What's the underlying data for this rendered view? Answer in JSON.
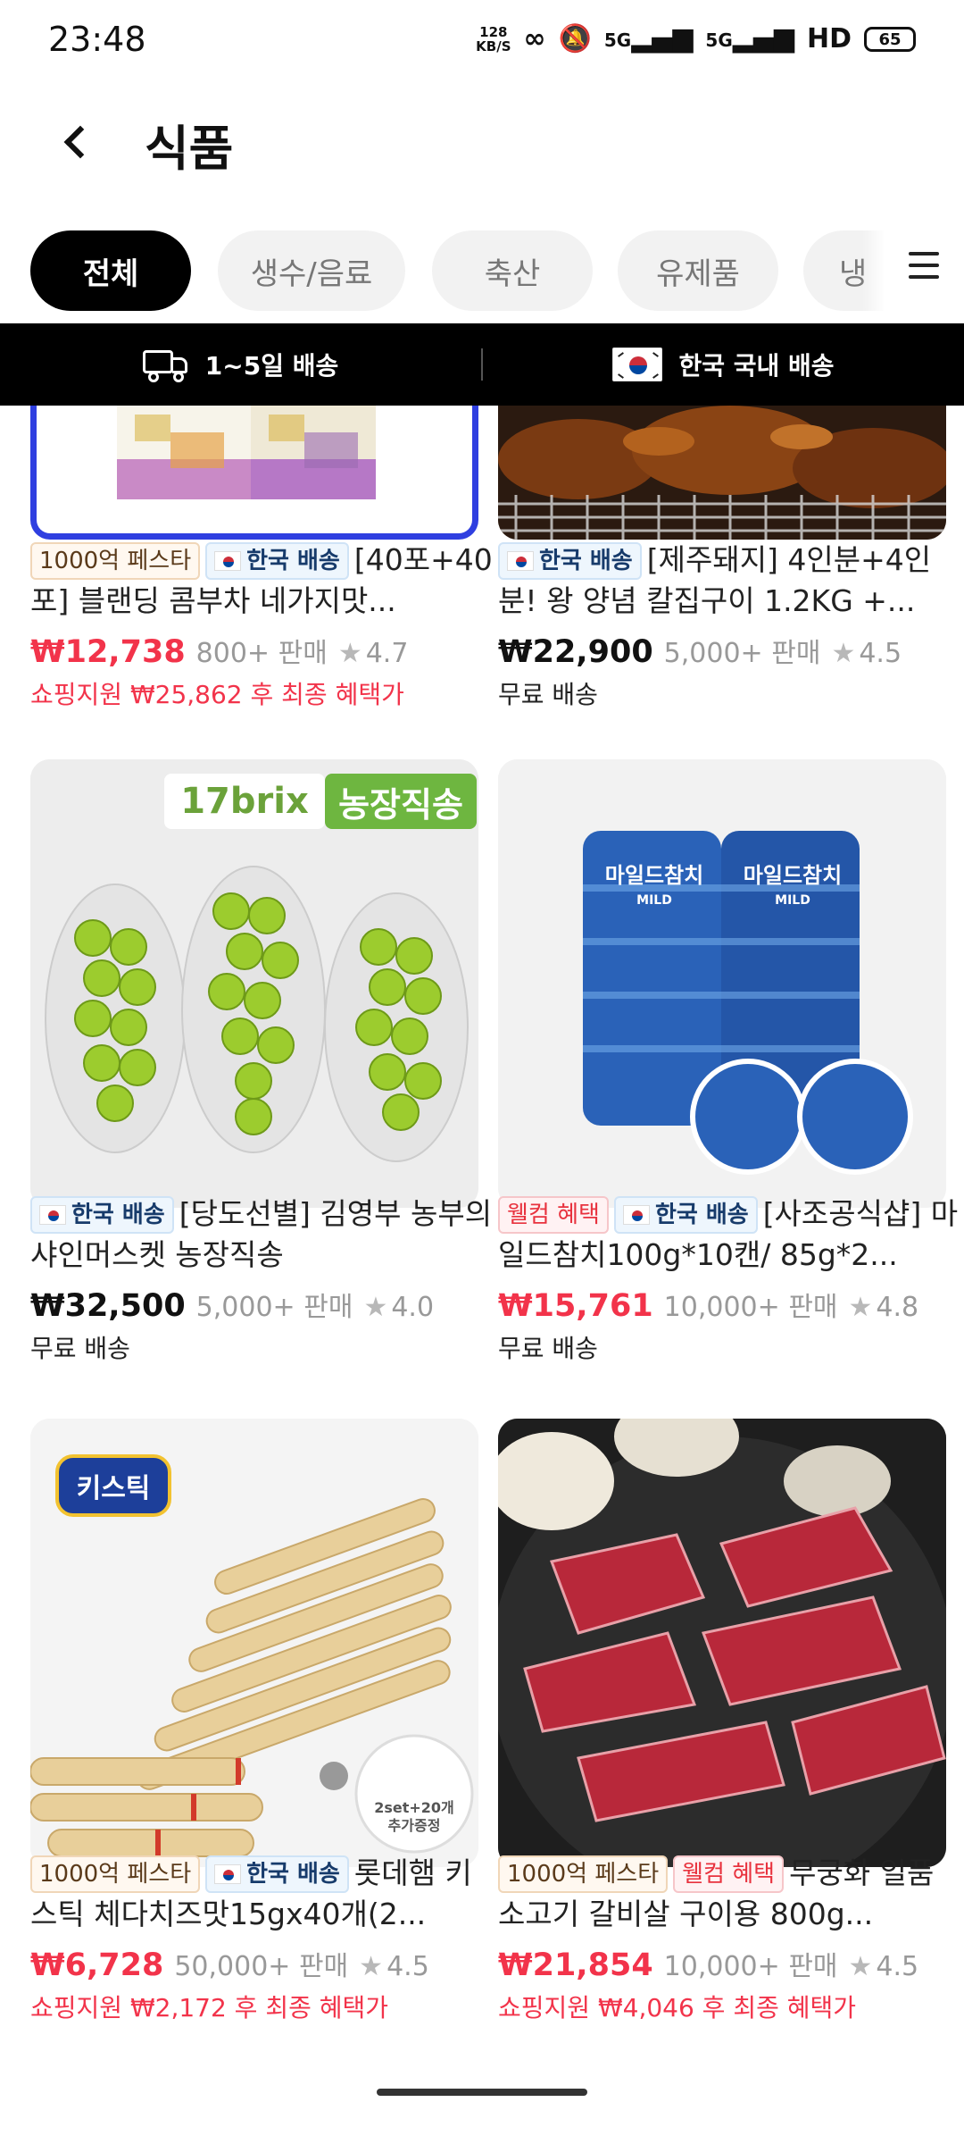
{
  "status_bar": {
    "time": "23:48",
    "net_speed_top": "128",
    "net_speed_bottom": "KB/S",
    "signal1": "5G",
    "signal2": "5G",
    "hd": "HD",
    "battery": "65"
  },
  "header": {
    "title": "식품"
  },
  "chips": [
    {
      "label": "전체",
      "active": true
    },
    {
      "label": "생수/음료",
      "active": false
    },
    {
      "label": "축산",
      "active": false
    },
    {
      "label": "유제품",
      "active": false
    },
    {
      "label": "냉",
      "active": false
    }
  ],
  "banner": {
    "left_text": "1~5일 배송",
    "right_text": "한국 국내 배송"
  },
  "products": [
    {
      "badges": [
        "1000억 페스타",
        "한국 배송"
      ],
      "title": "[40포+40포] 블랜딩 콤부차 네가지맛...",
      "price": "₩12,738",
      "sold": "800+ 판매",
      "rating": "4.7",
      "sub": "쇼핑지원 ₩25,862 후 최종 혜택가"
    },
    {
      "badges": [
        "한국 배송"
      ],
      "title": "[제주돼지] 4인분+4인분! 왕 양념 칼집구이 1.2KG +...",
      "price": "₩22,900",
      "sold": "5,000+ 판매",
      "rating": "4.5",
      "sub": "무료 배송"
    },
    {
      "badges": [
        "한국 배송"
      ],
      "title": "[당도선별] 김영부 농부의 샤인머스켓 농장직송",
      "price": "₩32,500",
      "sold": "5,000+ 판매",
      "rating": "4.0",
      "sub": "무료 배송",
      "image_tags": [
        "17brix",
        "농장직송"
      ]
    },
    {
      "badges": [
        "웰컴 혜택",
        "한국 배송"
      ],
      "title": "[사조공식샵] 마일드참치100g*10캔/ 85g*2...",
      "price": "₩15,761",
      "sold": "10,000+ 판매",
      "rating": "4.8",
      "sub": "무료 배송",
      "image_tags": [
        "마일드참치",
        "MILD"
      ]
    },
    {
      "badges": [
        "1000억 페스타",
        "한국 배송"
      ],
      "title": "롯데햄 키스틱 체다치즈맛15gx40개(2...",
      "price": "₩6,728",
      "sold": "50,000+ 판매",
      "rating": "4.5",
      "sub": "쇼핑지원 ₩2,172 후 최종 혜택가",
      "image_tags": [
        "키스틱",
        "2set+20개",
        "추가증정"
      ]
    },
    {
      "badges": [
        "1000억 페스타",
        "웰컴 혜택"
      ],
      "title": "무궁화 일품 소고기 갈비살 구이용 800g...",
      "price": "₩21,854",
      "sold": "10,000+ 판매",
      "rating": "4.5",
      "sub": "쇼핑지원 ₩4,046 후 최종 혜택가"
    }
  ],
  "colors": {
    "accent_red": "#f2334a",
    "banner_bg": "#000000",
    "chip_active_bg": "#000000",
    "chip_bg": "#f2f2f2"
  }
}
